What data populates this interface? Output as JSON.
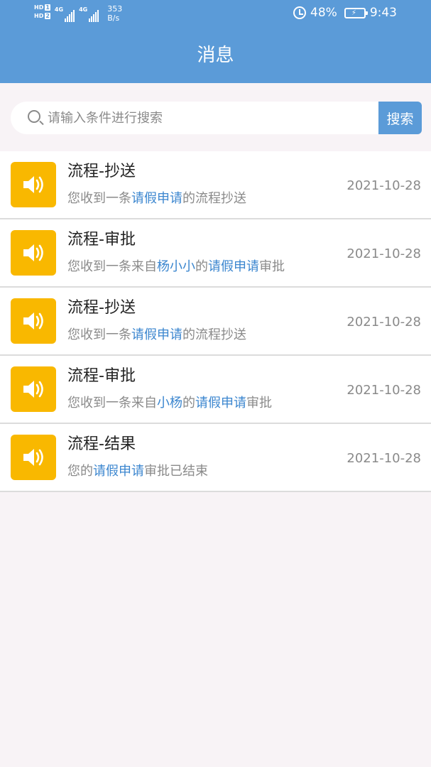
{
  "status": {
    "hd1": "HD",
    "hd1_num": "1",
    "hd2": "HD",
    "hd2_num": "2",
    "sig1_label": "4G",
    "sig2_label": "4G",
    "speed_value": "353",
    "speed_unit": "B/s",
    "battery": "48%",
    "time": "9:43"
  },
  "header": {
    "title": "消息"
  },
  "search": {
    "placeholder": "请输入条件进行搜索",
    "button_label": "搜索"
  },
  "colors": {
    "header": "#5b9bd8",
    "accent": "#3b86cf",
    "avatar": "#f9b800"
  },
  "messages": [
    {
      "title": "流程-抄送",
      "date": "2021-10-28",
      "parts": [
        {
          "text": "您收到一条"
        },
        {
          "text": "请假申请",
          "hl": true
        },
        {
          "text": "的流程抄送"
        }
      ]
    },
    {
      "title": "流程-审批",
      "date": "2021-10-28",
      "parts": [
        {
          "text": "您收到一条来自"
        },
        {
          "text": "杨小小",
          "hl": true
        },
        {
          "text": "的"
        },
        {
          "text": "请假申请",
          "hl": true
        },
        {
          "text": "审批"
        }
      ]
    },
    {
      "title": "流程-抄送",
      "date": "2021-10-28",
      "parts": [
        {
          "text": "您收到一条"
        },
        {
          "text": "请假申请",
          "hl": true
        },
        {
          "text": "的流程抄送"
        }
      ]
    },
    {
      "title": "流程-审批",
      "date": "2021-10-28",
      "parts": [
        {
          "text": "您收到一条来自"
        },
        {
          "text": "小杨",
          "hl": true
        },
        {
          "text": "的"
        },
        {
          "text": "请假申请",
          "hl": true
        },
        {
          "text": "审批"
        }
      ]
    },
    {
      "title": "流程-结果",
      "date": "2021-10-28",
      "parts": [
        {
          "text": "您的"
        },
        {
          "text": "请假申请",
          "hl": true
        },
        {
          "text": "审批已结束"
        }
      ]
    }
  ]
}
